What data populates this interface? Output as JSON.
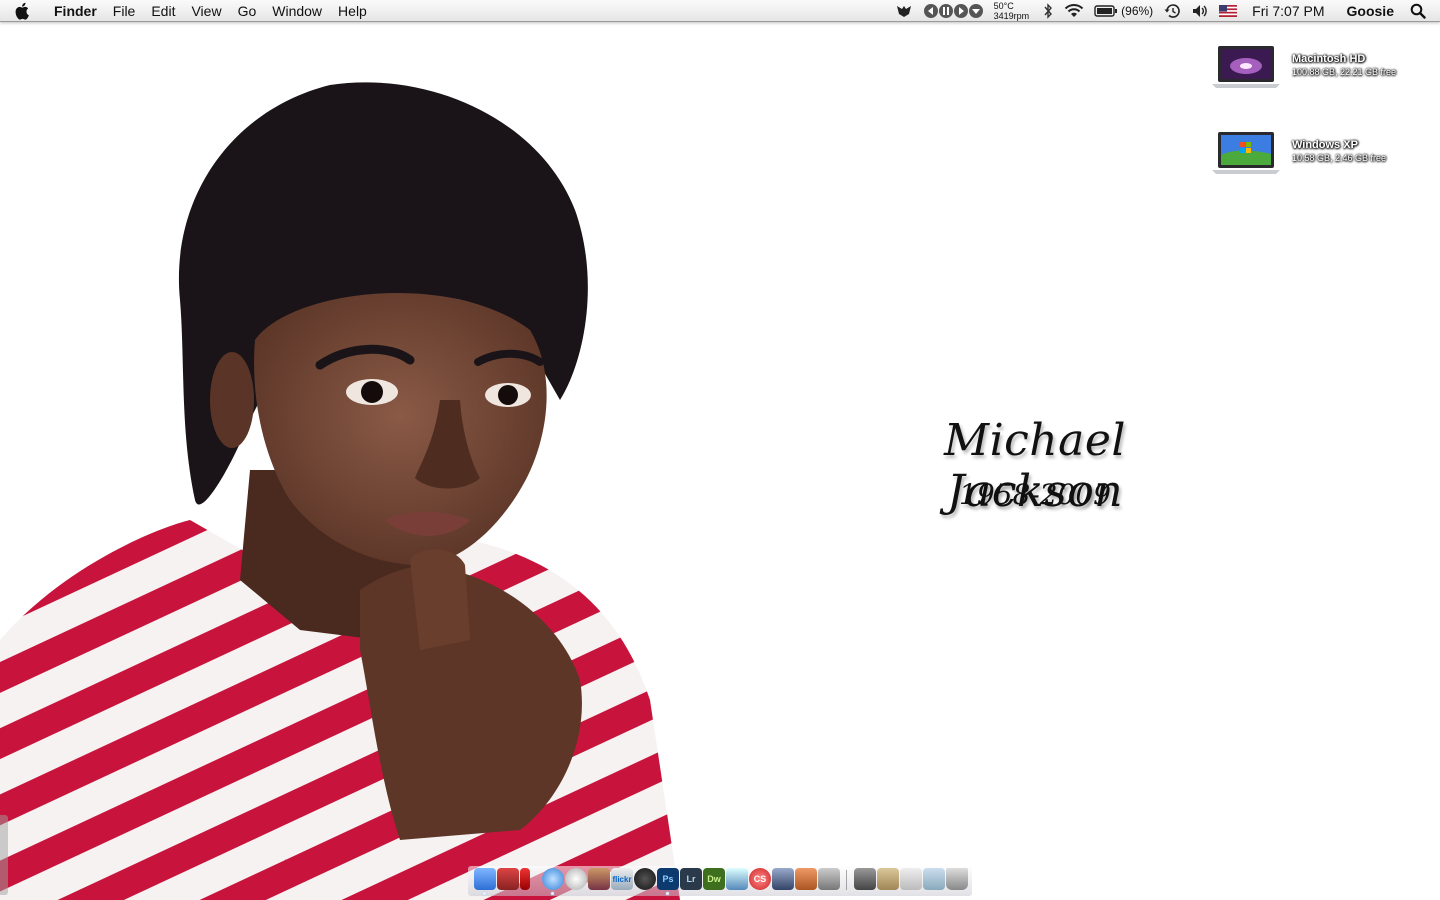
{
  "menubar": {
    "app_name": "Finder",
    "menus": [
      "File",
      "Edit",
      "View",
      "Go",
      "Window",
      "Help"
    ],
    "status": {
      "temperature": "50°C",
      "fan_speed": "3419rpm",
      "battery_percent": "(96%)",
      "clock": "Fri 7:07 PM",
      "user": "Goosie"
    }
  },
  "wallpaper": {
    "name": "Michael Jackson",
    "years": "1958-2009"
  },
  "desktop": {
    "disks": [
      {
        "name": "Macintosh HD",
        "info": "100.88 GB, 22.21 GB free"
      },
      {
        "name": "Windows XP",
        "info": "10.58 GB, 2.46 GB free"
      }
    ]
  },
  "dock": {
    "apps": [
      {
        "name": "finder",
        "label": ""
      },
      {
        "name": "photo-booth",
        "label": ""
      },
      {
        "name": "marker",
        "label": ""
      },
      {
        "name": "safari",
        "label": ""
      },
      {
        "name": "compass",
        "label": ""
      },
      {
        "name": "iphoto",
        "label": ""
      },
      {
        "name": "flickr-uploadr",
        "label": "flickr"
      },
      {
        "name": "dvd-player",
        "label": ""
      },
      {
        "name": "photoshop",
        "label": "Ps"
      },
      {
        "name": "lightroom",
        "label": "Lr"
      },
      {
        "name": "dreamweaver",
        "label": "Dw"
      },
      {
        "name": "itunes",
        "label": ""
      },
      {
        "name": "creative-suite",
        "label": "CS"
      },
      {
        "name": "pen-tool",
        "label": ""
      },
      {
        "name": "keynote",
        "label": ""
      },
      {
        "name": "system-preferences",
        "label": ""
      }
    ],
    "stacks": [
      "screenshots-stack",
      "applications-stack",
      "documents-stack",
      "downloads-stack"
    ]
  },
  "colors": {
    "menubar": "#ececec",
    "shirt_red": "#c8143c",
    "skin": "#6e4434",
    "hair": "#1a1418"
  }
}
